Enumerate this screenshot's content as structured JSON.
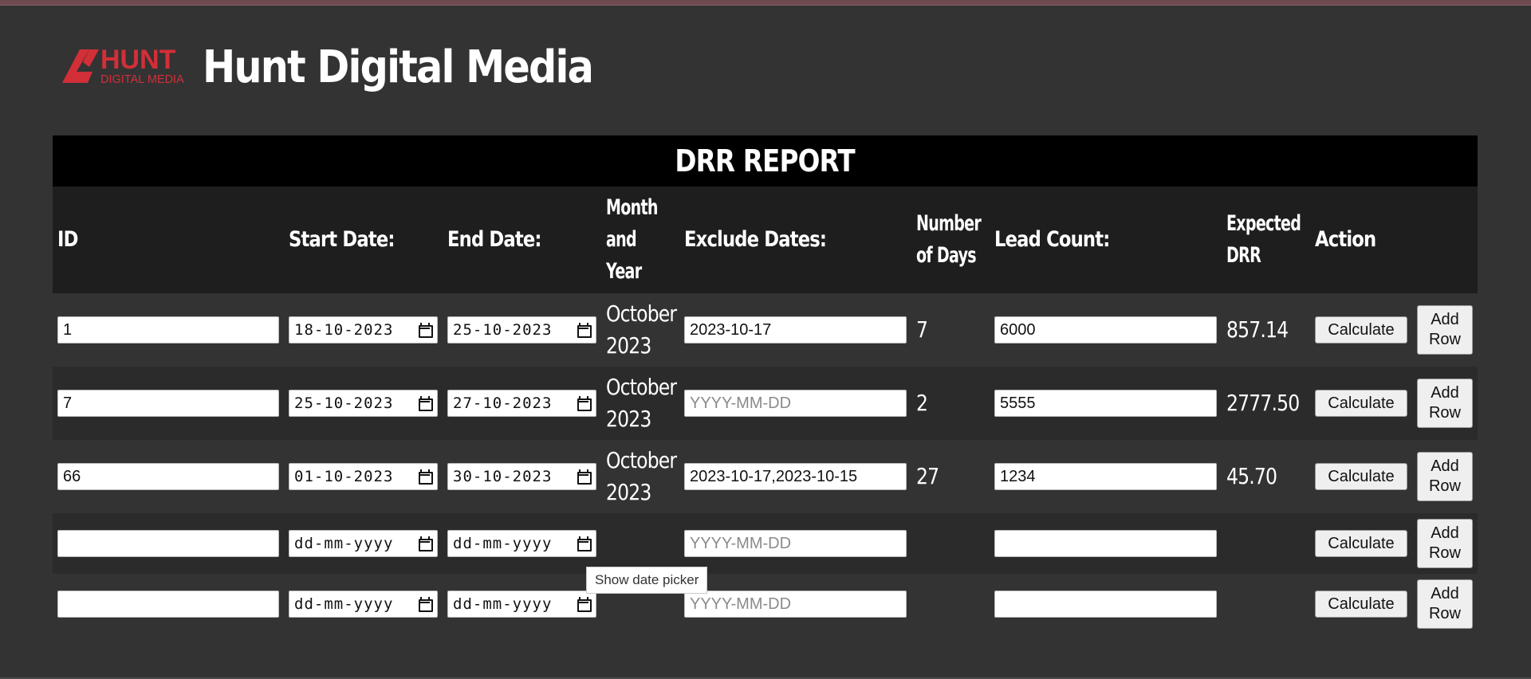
{
  "brand": {
    "logo_word": "HUNT",
    "logo_sub": "DIGITAL MEDIA",
    "title": "Hunt Digital Media",
    "accent_color": "#d22f38"
  },
  "report": {
    "title": "DRR REPORT",
    "headers": {
      "id": "ID",
      "start_date": "Start Date:",
      "end_date": "End Date:",
      "month_year": [
        "Month",
        "and",
        "Year"
      ],
      "exclude_dates": "Exclude Dates:",
      "num_days": [
        "Number",
        "of Days"
      ],
      "lead_count": "Lead Count:",
      "expected_drr": [
        "Expected",
        "DRR"
      ],
      "action": "Action"
    },
    "exclude_placeholder": "YYYY-MM-DD",
    "date_placeholder": "dd-mm-yyyy",
    "calculate_label": "Calculate",
    "add_row_label": [
      "Add",
      "Row"
    ],
    "rows": [
      {
        "id": "1",
        "start": "18-10-2023",
        "end": "25-10-2023",
        "month_year": [
          "October",
          "2023"
        ],
        "exclude": "2023-10-17",
        "days": "7",
        "lead_count": "6000",
        "drr": "857.14"
      },
      {
        "id": "7",
        "start": "25-10-2023",
        "end": "27-10-2023",
        "month_year": [
          "October",
          "2023"
        ],
        "exclude": "",
        "days": "2",
        "lead_count": "5555",
        "drr": "2777.50"
      },
      {
        "id": "66",
        "start": "01-10-2023",
        "end": "30-10-2023",
        "month_year": [
          "October",
          "2023"
        ],
        "exclude": "2023-10-17,2023-10-15",
        "days": "27",
        "lead_count": "1234",
        "drr": "45.70"
      },
      {
        "id": "",
        "start": "dd-mm-yyyy",
        "end": "dd-mm-yyyy",
        "month_year": [
          "",
          ""
        ],
        "exclude": "",
        "days": "",
        "lead_count": "",
        "drr": ""
      },
      {
        "id": "",
        "start": "dd-mm-yyyy",
        "end": "dd-mm-yyyy",
        "month_year": [
          "",
          ""
        ],
        "exclude": "",
        "days": "",
        "lead_count": "",
        "drr": ""
      }
    ]
  },
  "tooltip": "Show date picker"
}
